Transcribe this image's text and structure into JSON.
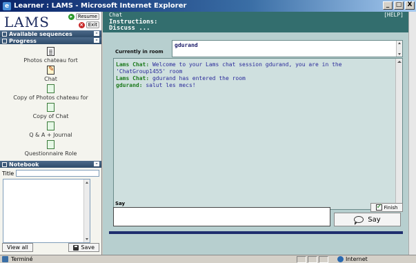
{
  "window": {
    "title": "Learner : LAMS - Microsoft Internet Explorer",
    "min_label": "_",
    "max_label": "□",
    "close_label": "X"
  },
  "left": {
    "logo": "LAMS",
    "resume_label": "Resume",
    "exit_label": "Exit",
    "available_sequences": "Available sequences",
    "progress_header": "Progress",
    "activities": [
      {
        "label": "Photos chateau fort",
        "icon": "document-icon"
      },
      {
        "label": "Chat",
        "icon": "edit-document-icon"
      },
      {
        "label": "Copy of Photos chateau for",
        "icon": "document-icon"
      },
      {
        "label": "Copy of Chat",
        "icon": "document-icon"
      },
      {
        "label": "Q & A + Journal",
        "icon": "document-icon"
      },
      {
        "label": "Questionnaire Role",
        "icon": "document-icon"
      }
    ],
    "notebook_header": "Notebook",
    "notebook_title_label": "Title",
    "view_all_label": "View all",
    "save_label": "Save"
  },
  "main": {
    "chat_title": "Chat",
    "help_label": "[HELP]",
    "instructions_label": "Instructions:",
    "discuss_label": "Discuss ...",
    "currently_in_room_label": "Currently in room",
    "room_user": "gdurand",
    "messages": [
      {
        "sender": "Lams Chat:",
        "text": " Welcome to your Lams chat session gdurand, you are in the 'ChatGroup1455' room"
      },
      {
        "sender": "Lams Chat:",
        "text": " gdurand has entered the room"
      },
      {
        "sender": "gdurand:",
        "text": " salut les mecs!"
      }
    ],
    "say_label": "Say",
    "finish_label": "Finish",
    "say_button_label": "Say"
  },
  "status": {
    "text": "Terminé",
    "zone": "Internet"
  },
  "colors": {
    "header": "#336e6e",
    "panel": "#b7cfcf",
    "sender": "#1d7a1d",
    "message": "#2a2a9a"
  }
}
